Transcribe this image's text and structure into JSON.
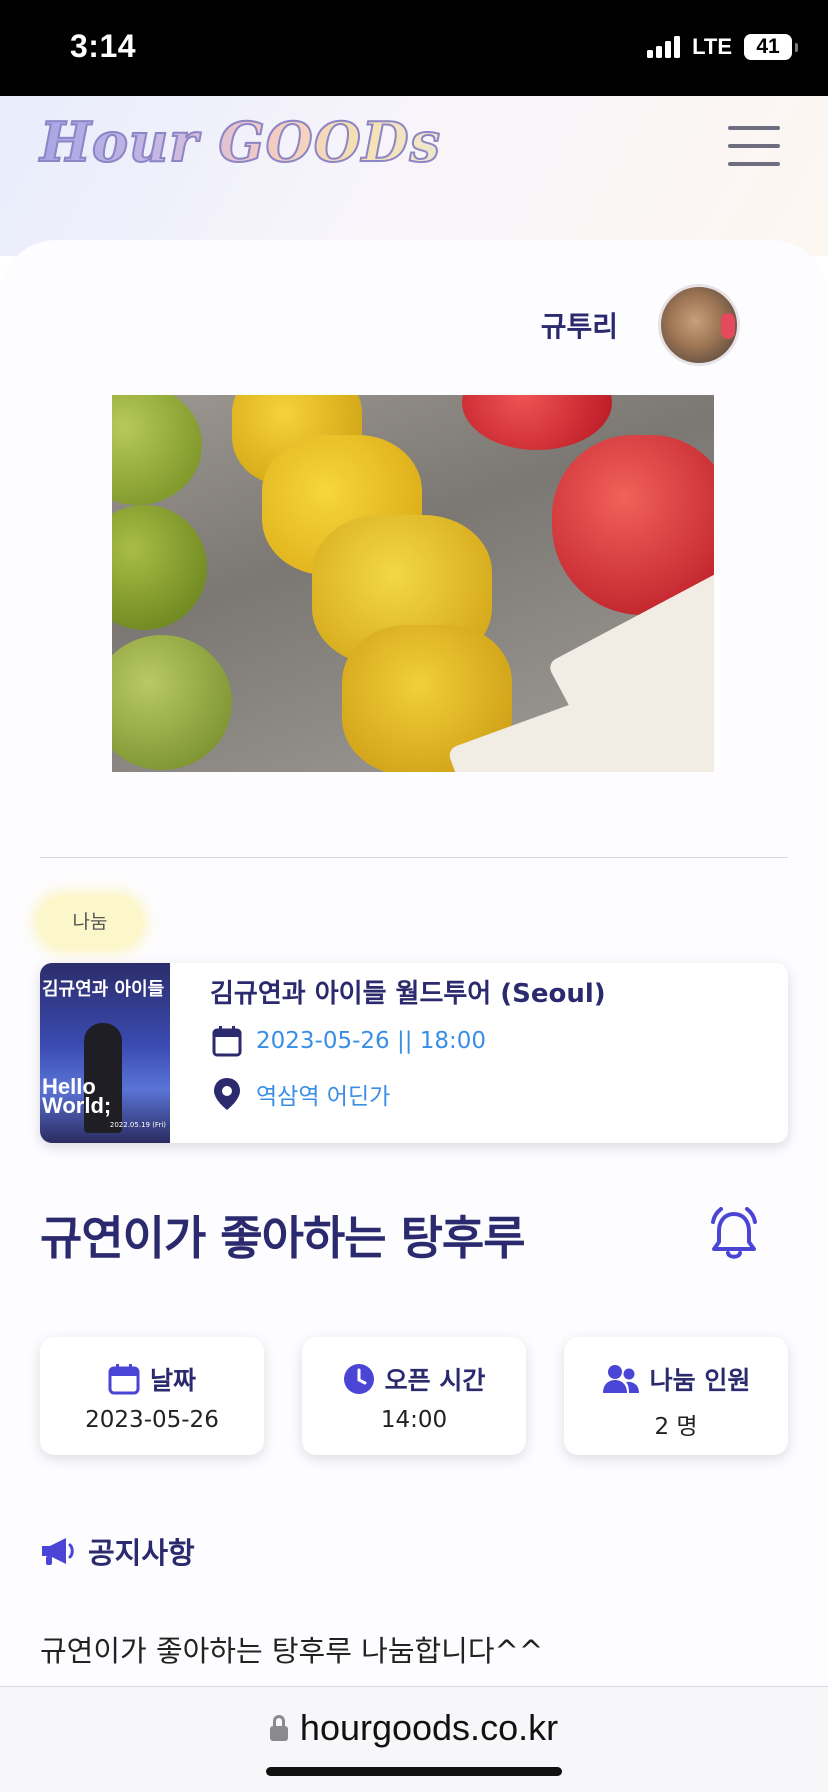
{
  "status_bar": {
    "time": "3:14",
    "network": "LTE",
    "battery": "41"
  },
  "header": {
    "logo": "Hour GOODs",
    "menu_icon": "hamburger-menu-icon"
  },
  "post": {
    "author": "규투리",
    "category": "나눔",
    "event": {
      "thumbnail_title": "김규연과 아이들",
      "thumbnail_text": "Hello World;",
      "thumbnail_date": "2022.05.19 (Fri)",
      "title": "김규연과 아이들 월드투어 (Seoul)",
      "datetime": "2023-05-26 || 18:00",
      "place": "역삼역 어딘가"
    },
    "title": "규연이가 좋아하는 탕후루",
    "info": [
      {
        "icon": "calendar-icon",
        "label": "날짜",
        "value": "2023-05-26"
      },
      {
        "icon": "clock-icon",
        "label": "오픈 시간",
        "value": "14:00"
      },
      {
        "icon": "users-icon",
        "label": "나눔 인원",
        "value": "2 명"
      }
    ],
    "notice_label": "공지사항",
    "notice_text": "규연이가 좋아하는 탕후루 나눔합니다^^"
  },
  "browser": {
    "url": "hourgoods.co.kr"
  },
  "colors": {
    "primary": "#2b2a6e",
    "accent": "#3a8ee6",
    "icon": "#4b45d6"
  }
}
